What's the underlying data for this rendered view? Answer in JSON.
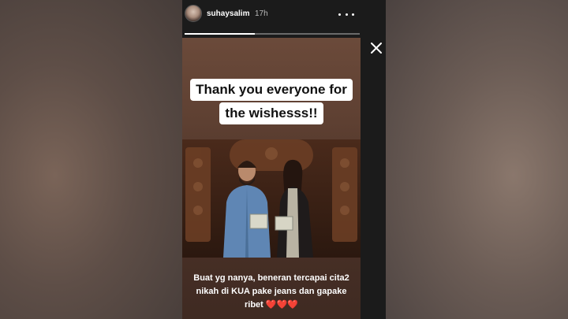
{
  "header": {
    "username": "suhaysalim",
    "time": "17h",
    "progress": 0.4
  },
  "icons": {
    "close": "close-icon",
    "more": "more-options-icon",
    "avatar": "avatar"
  },
  "story": {
    "caption_top": [
      "Thank you everyone for",
      "the wishesss!!"
    ],
    "caption_bottom": "Buat yg nanya, beneran tercapai cita2 nikah di KUA pake jeans dan gapake ribet",
    "hearts": "❤️❤️❤️"
  },
  "colors": {
    "story_bg": "#1b1b1b",
    "accent_white": "#ffffff"
  }
}
